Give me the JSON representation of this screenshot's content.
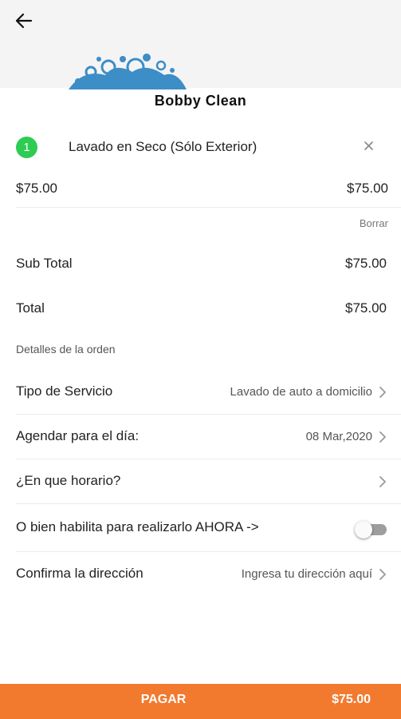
{
  "store": {
    "name": "Bobby Clean"
  },
  "cart": {
    "items": [
      {
        "qty": "1",
        "name": "Lavado en Seco (Sólo Exterior)",
        "unit_price": "$75.00",
        "line_total": "$75.00",
        "remove_icon": "close-icon"
      }
    ],
    "delete_label": "Borrar"
  },
  "totals": {
    "subtotal_label": "Sub Total",
    "subtotal_value": "$75.00",
    "total_label": "Total",
    "total_value": "$75.00"
  },
  "order_details": {
    "title": "Detalles de la orden",
    "service_type_label": "Tipo de Servicio",
    "service_type_value": "Lavado de auto a domicilio",
    "schedule_day_label": "Agendar para el día:",
    "schedule_day_value": "08 Mar,2020",
    "schedule_time_label": "¿En que horario?",
    "now_label": "O bien habilita para realizarlo AHORA ->",
    "now_enabled": false,
    "address_label": "Confirma la dirección",
    "address_value": "Ingresa tu dirección aquí"
  },
  "pay": {
    "label": "PAGAR",
    "amount": "$75.00"
  },
  "colors": {
    "accent": "#f27a2f",
    "badge": "#2ecc52",
    "logo": "#3d8dc7"
  }
}
